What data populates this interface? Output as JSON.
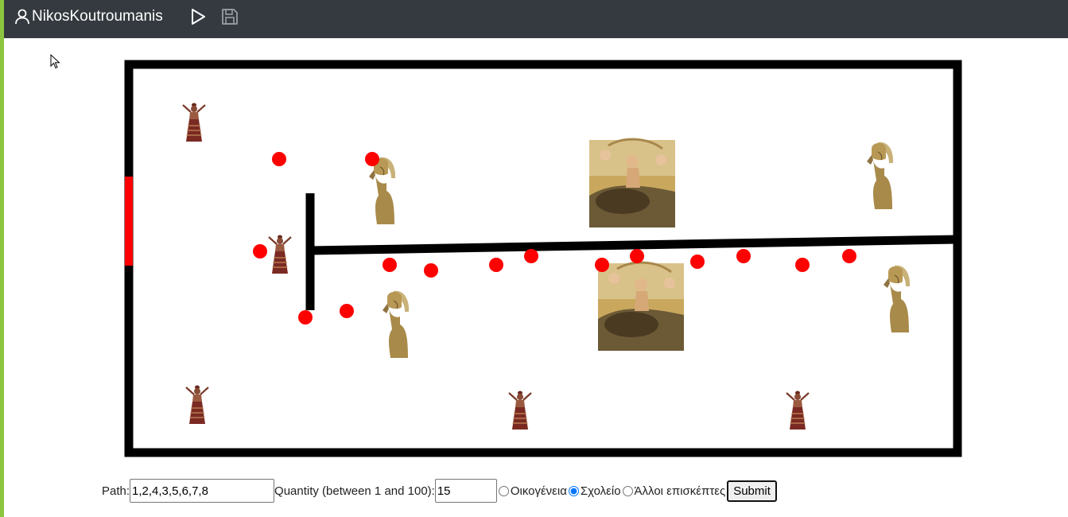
{
  "topbar": {
    "username": "NikosKoutroumanis",
    "user_icon": "user-icon",
    "play_icon": "play-icon",
    "save_icon": "save-icon"
  },
  "colors": {
    "topbar": "#343a40",
    "accent": "#8cc63f",
    "walls": "#000000",
    "entrance": "#ff0000",
    "path_points": "#ff0000"
  },
  "map": {
    "exhibit_icons": [
      "snake-goddess-statue",
      "warrior-bust-statue",
      "europa-mosaic-painting"
    ]
  },
  "form": {
    "path_label": "Path:",
    "path_value": "1,2,4,3,5,6,7,8",
    "quantity_label": "Quantity (between 1 and 100):",
    "quantity_value": "15",
    "radio_options": [
      {
        "label": "Οικογένεια",
        "checked": false
      },
      {
        "label": "Σχολείο",
        "checked": true
      },
      {
        "label": "Άλλοι επισκέπτες",
        "checked": false
      }
    ],
    "submit_label": "Submit"
  }
}
